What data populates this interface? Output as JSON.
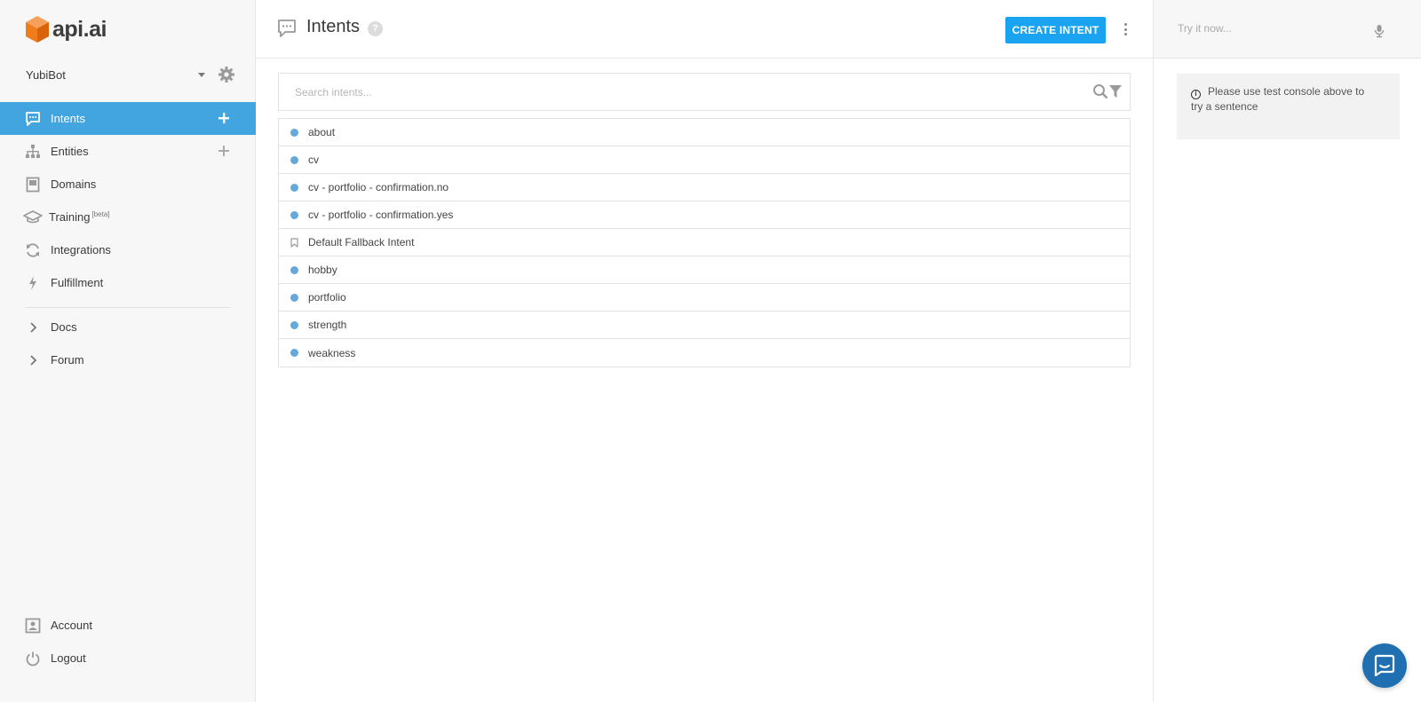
{
  "brand": {
    "name": "api.ai",
    "accent": "#42a5df",
    "logo_color": "#f07c1a"
  },
  "sidebar": {
    "agent_name": "YubiBot",
    "items": [
      {
        "label": "Intents",
        "icon": "chat-bubble-icon",
        "active": true,
        "has_add": true
      },
      {
        "label": "Entities",
        "icon": "hierarchy-icon",
        "active": false,
        "has_add": true
      },
      {
        "label": "Domains",
        "icon": "book-icon",
        "active": false,
        "has_add": false
      },
      {
        "label": "Training",
        "badge": "[beta]",
        "icon": "graduation-cap-icon",
        "active": false,
        "has_add": false
      },
      {
        "label": "Integrations",
        "icon": "sync-icon",
        "active": false,
        "has_add": false
      },
      {
        "label": "Fulfillment",
        "icon": "lightning-icon",
        "active": false,
        "has_add": false
      }
    ],
    "links": [
      {
        "label": "Docs",
        "icon": "chevron-right-icon"
      },
      {
        "label": "Forum",
        "icon": "chevron-right-icon"
      }
    ],
    "bottom": [
      {
        "label": "Account",
        "icon": "account-icon"
      },
      {
        "label": "Logout",
        "icon": "power-icon"
      }
    ]
  },
  "main": {
    "title": "Intents",
    "help": "?",
    "create_button": "CREATE INTENT",
    "search_placeholder": "Search intents...",
    "intents": [
      {
        "name": "about",
        "type": "dot"
      },
      {
        "name": "cv",
        "type": "dot"
      },
      {
        "name": "cv - portfolio - confirmation.no",
        "type": "dot"
      },
      {
        "name": "cv - portfolio - confirmation.yes",
        "type": "dot"
      },
      {
        "name": "Default Fallback Intent",
        "type": "bookmark"
      },
      {
        "name": "hobby",
        "type": "dot"
      },
      {
        "name": "portfolio",
        "type": "dot"
      },
      {
        "name": "strength",
        "type": "dot"
      },
      {
        "name": "weakness",
        "type": "dot"
      }
    ]
  },
  "console": {
    "placeholder": "Try it now...",
    "info_line1": "Please use test console above to",
    "info_line2": "try a sentence",
    "info_icon": "i"
  }
}
